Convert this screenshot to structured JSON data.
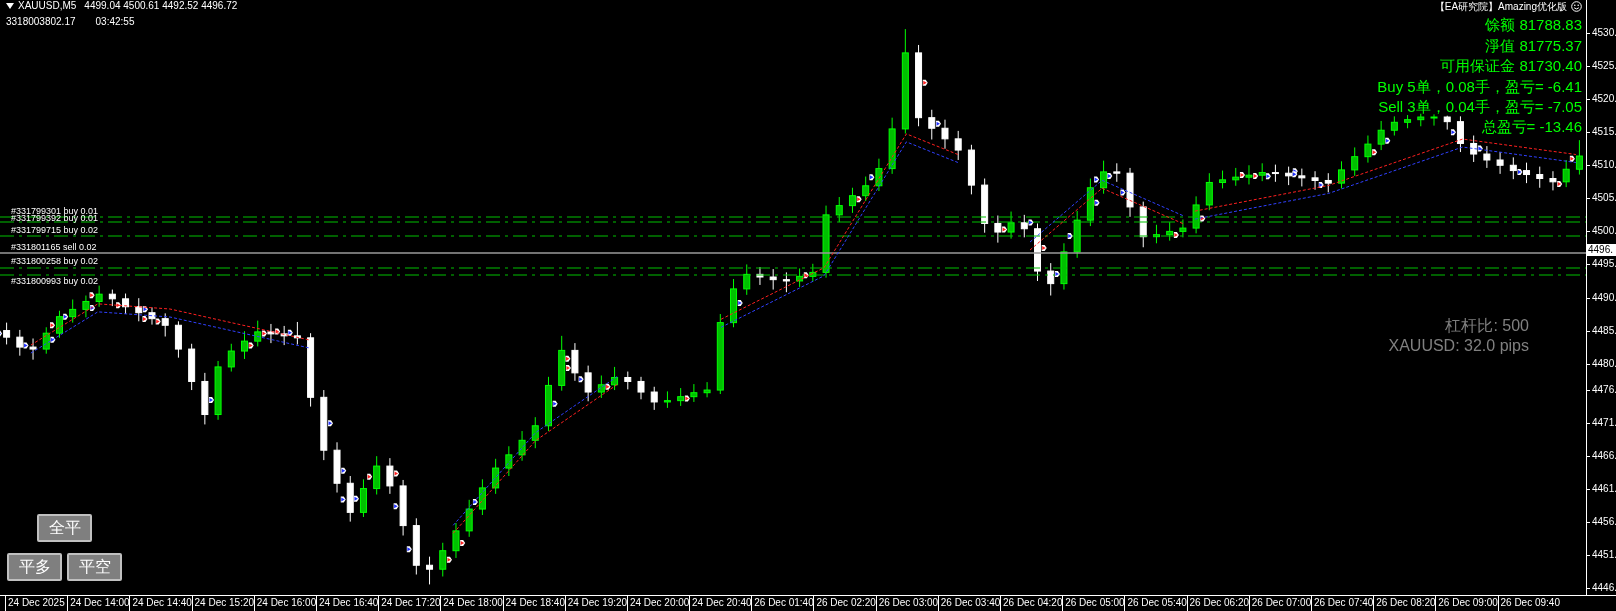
{
  "header": {
    "symbol": "XAUUSD,M5",
    "ohlc": "4499.04 4500.61 4492.52 4496.72",
    "account": "3318003802.17",
    "time": "03:42:55"
  },
  "panel": {
    "title": "【EA研究院】Amazing优化版",
    "lines": [
      {
        "text": "馀额 81788.83"
      },
      {
        "text": "淨值 81775.37"
      },
      {
        "text": "可用保证金 81730.40"
      },
      {
        "text": "Buy 5单，0.08手，盈亏= -6.41"
      },
      {
        "text": "Sell 3单，0.04手，盈亏= -7.05"
      },
      {
        "text": "总盈亏= -13.46"
      }
    ]
  },
  "info": [
    "杠杆比: 500",
    "XAUUSD: 32.0 pips"
  ],
  "order_lines": [
    {
      "label": "#331799301 buy 0.01",
      "kind": "order"
    },
    {
      "label": "#331799392 buy 0.01",
      "kind": "order"
    },
    {
      "label": "#331799715 buy 0.02",
      "kind": "order"
    },
    {
      "label": "#331801165 sell 0.02",
      "kind": "bid"
    },
    {
      "label": "#331800258 buy 0.02",
      "kind": "order"
    },
    {
      "label": "#331800993 buy 0.02",
      "kind": "order"
    }
  ],
  "buttons": [
    "全平",
    "平多",
    "平空"
  ],
  "chart": {
    "chart_data": {
      "type": "candlestick",
      "categories": [
        null,
        null,
        null,
        null,
        null,
        null,
        null,
        null,
        null,
        null,
        null,
        null,
        null,
        null,
        null,
        null,
        null,
        null,
        null,
        null,
        null,
        null,
        null,
        null,
        null,
        null,
        null,
        null,
        null,
        null,
        null,
        null,
        null,
        null,
        null,
        null,
        null,
        null,
        null,
        null,
        null,
        null,
        null,
        null,
        null,
        null,
        null,
        null,
        null,
        null,
        null,
        null,
        null,
        null,
        null,
        null,
        null,
        null,
        null,
        null,
        null,
        null,
        null,
        null,
        null,
        null,
        null,
        null,
        null,
        null,
        null,
        null,
        null,
        null,
        null,
        null,
        null,
        null,
        null,
        null,
        null,
        null,
        null,
        null,
        null,
        null,
        null,
        null,
        null,
        null,
        null,
        null,
        null,
        null,
        null,
        null,
        null,
        null,
        null,
        null,
        null,
        null,
        null,
        null,
        null,
        null,
        null,
        null,
        null,
        null,
        null,
        null,
        null,
        null,
        null,
        null,
        null,
        null,
        null,
        null
      ],
      "ylim": [
        4445,
        4535
      ],
      "yticks": [
        {
          "value": 4530,
          "label": "4530."
        },
        {
          "value": 4525,
          "label": "4525."
        },
        {
          "value": 4520,
          "label": "4520."
        },
        {
          "value": 4515,
          "label": "4515."
        },
        {
          "value": 4510,
          "label": "4510."
        },
        {
          "value": 4505,
          "label": "4505."
        },
        {
          "value": 4500,
          "label": "4500."
        },
        {
          "value": 4495,
          "label": "4495."
        },
        {
          "value": 4490,
          "label": "4490."
        },
        {
          "value": 4485,
          "label": "4485."
        },
        {
          "value": 4480,
          "label": "4480."
        },
        {
          "value": 4476,
          "label": "4476."
        },
        {
          "value": 4471,
          "label": "4471."
        },
        {
          "value": 4466,
          "label": "4466."
        },
        {
          "value": 4461,
          "label": "4461."
        },
        {
          "value": 4456,
          "label": "4456."
        },
        {
          "value": 4451,
          "label": "4451."
        },
        {
          "value": 4446,
          "label": "4446."
        }
      ],
      "ohlc": [
        [
          4485.0,
          4486.2,
          4482.9,
          4484.0
        ],
        [
          4484.0,
          4485.1,
          4481.2,
          4482.5
        ],
        [
          4482.5,
          4483.8,
          4480.6,
          4482.2
        ],
        [
          4482.2,
          4485.5,
          4481.5,
          4484.6
        ],
        [
          4484.6,
          4488.0,
          4483.9,
          4487.1
        ],
        [
          4487.1,
          4489.7,
          4486.2,
          4488.2
        ],
        [
          4488.2,
          4490.3,
          4487.0,
          4489.4
        ],
        [
          4489.4,
          4491.8,
          4488.6,
          4490.5
        ],
        [
          4490.5,
          4491.2,
          4488.7,
          4489.8
        ],
        [
          4489.8,
          4490.6,
          4487.5,
          4488.6
        ],
        [
          4488.6,
          4489.9,
          4486.4,
          4487.7
        ],
        [
          4487.7,
          4488.5,
          4485.9,
          4486.8
        ],
        [
          4486.8,
          4487.6,
          4484.1,
          4485.8
        ],
        [
          4485.8,
          4486.4,
          4480.9,
          4482.2
        ],
        [
          4482.2,
          4483.0,
          4476.0,
          4477.3
        ],
        [
          4477.3,
          4478.6,
          4470.8,
          4472.3
        ],
        [
          4472.3,
          4480.4,
          4471.5,
          4479.5
        ],
        [
          4479.5,
          4483.0,
          4478.8,
          4481.9
        ],
        [
          4481.9,
          4484.9,
          4480.7,
          4483.4
        ],
        [
          4483.4,
          4486.5,
          4482.6,
          4484.8
        ],
        [
          4484.8,
          4486.0,
          4483.1,
          4484.5
        ],
        [
          4484.5,
          4485.7,
          4482.8,
          4484.2
        ],
        [
          4484.2,
          4486.3,
          4482.9,
          4483.9
        ],
        [
          4483.9,
          4484.6,
          4473.5,
          4474.9
        ],
        [
          4474.9,
          4476.0,
          4465.4,
          4466.9
        ],
        [
          4466.9,
          4468.1,
          4460.5,
          4461.9
        ],
        [
          4461.9,
          4463.0,
          4456.1,
          4457.5
        ],
        [
          4457.5,
          4462.5,
          4456.8,
          4461.1
        ],
        [
          4461.1,
          4466.0,
          4460.2,
          4464.5
        ],
        [
          4464.5,
          4465.7,
          4460.3,
          4461.5
        ],
        [
          4461.5,
          4462.4,
          4454.0,
          4455.5
        ],
        [
          4455.5,
          4456.6,
          4448.1,
          4449.5
        ],
        [
          4449.5,
          4450.8,
          4446.6,
          4448.9
        ],
        [
          4448.9,
          4452.9,
          4447.8,
          4451.7
        ],
        [
          4451.7,
          4455.9,
          4450.6,
          4454.7
        ],
        [
          4454.7,
          4459.4,
          4453.8,
          4458.0
        ],
        [
          4458.0,
          4462.5,
          4457.1,
          4461.2
        ],
        [
          4461.2,
          4465.6,
          4460.3,
          4464.2
        ],
        [
          4464.2,
          4467.5,
          4463.0,
          4466.2
        ],
        [
          4466.2,
          4469.8,
          4465.3,
          4468.4
        ],
        [
          4468.4,
          4471.9,
          4467.2,
          4470.6
        ],
        [
          4470.6,
          4478.0,
          4469.8,
          4476.7
        ],
        [
          4476.7,
          4484.2,
          4475.9,
          4482.0
        ],
        [
          4482.0,
          4483.1,
          4477.4,
          4478.6
        ],
        [
          4478.6,
          4479.7,
          4474.3,
          4475.7
        ],
        [
          4475.7,
          4478.2,
          4474.8,
          4476.8
        ],
        [
          4476.8,
          4479.5,
          4476.0,
          4477.9
        ],
        [
          4477.9,
          4478.8,
          4476.1,
          4477.3
        ],
        [
          4477.3,
          4478.0,
          4474.6,
          4475.7
        ],
        [
          4475.7,
          4476.5,
          4473.0,
          4474.2
        ],
        [
          4474.2,
          4475.8,
          4473.3,
          4474.4
        ],
        [
          4474.4,
          4476.3,
          4473.6,
          4475.0
        ],
        [
          4475.0,
          4476.9,
          4474.2,
          4475.6
        ],
        [
          4475.6,
          4477.2,
          4474.9,
          4476.0
        ],
        [
          4476.0,
          4487.5,
          4475.4,
          4486.2
        ],
        [
          4486.2,
          4492.8,
          4485.5,
          4491.3
        ],
        [
          4491.3,
          4495.0,
          4490.4,
          4493.5
        ],
        [
          4493.5,
          4494.6,
          4491.9,
          4493.1
        ],
        [
          4493.1,
          4494.3,
          4491.2,
          4492.7
        ],
        [
          4492.7,
          4493.8,
          4490.8,
          4492.5
        ],
        [
          4492.5,
          4494.4,
          4491.6,
          4493.2
        ],
        [
          4493.2,
          4495.1,
          4492.4,
          4493.8
        ],
        [
          4493.8,
          4503.9,
          4493.0,
          4502.5
        ],
        [
          4502.5,
          4505.2,
          4501.4,
          4503.9
        ],
        [
          4503.9,
          4506.6,
          4502.8,
          4505.4
        ],
        [
          4505.4,
          4508.3,
          4504.6,
          4506.9
        ],
        [
          4506.9,
          4511.0,
          4506.1,
          4509.5
        ],
        [
          4509.5,
          4517.2,
          4508.7,
          4515.5
        ],
        [
          4515.5,
          4530.6,
          4514.8,
          4527.0
        ],
        [
          4527.0,
          4528.2,
          4515.9,
          4517.2
        ],
        [
          4517.2,
          4518.4,
          4513.9,
          4515.6
        ],
        [
          4515.6,
          4516.9,
          4512.5,
          4514.0
        ],
        [
          4514.0,
          4515.2,
          4510.8,
          4512.3
        ],
        [
          4512.3,
          4513.1,
          4505.6,
          4507.0
        ],
        [
          4507.0,
          4508.0,
          4499.8,
          4501.2
        ],
        [
          4501.2,
          4502.4,
          4498.3,
          4499.9
        ],
        [
          4499.9,
          4503.0,
          4498.9,
          4501.3
        ],
        [
          4501.3,
          4502.5,
          4499.1,
          4500.4
        ],
        [
          4500.4,
          4501.2,
          4492.5,
          4494.0
        ],
        [
          4494.0,
          4495.2,
          4490.3,
          4492.1
        ],
        [
          4492.1,
          4498.2,
          4491.2,
          4496.9
        ],
        [
          4496.9,
          4503.1,
          4496.0,
          4501.7
        ],
        [
          4501.7,
          4508.0,
          4500.8,
          4506.6
        ],
        [
          4506.6,
          4510.7,
          4505.7,
          4509.0
        ],
        [
          4509.0,
          4510.3,
          4507.5,
          4508.8
        ],
        [
          4508.8,
          4509.6,
          4502.2,
          4503.7
        ],
        [
          4503.7,
          4504.5,
          4497.6,
          4499.2
        ],
        [
          4499.2,
          4501.0,
          4498.2,
          4499.5
        ],
        [
          4499.5,
          4501.4,
          4498.6,
          4500.0
        ],
        [
          4500.0,
          4501.8,
          4499.1,
          4500.5
        ],
        [
          4500.5,
          4505.3,
          4499.7,
          4504.0
        ],
        [
          4504.0,
          4508.8,
          4503.2,
          4507.4
        ],
        [
          4507.4,
          4509.2,
          4506.5,
          4507.8
        ],
        [
          4507.8,
          4509.6,
          4506.9,
          4508.2
        ],
        [
          4508.2,
          4510.0,
          4507.1,
          4508.5
        ],
        [
          4508.5,
          4510.3,
          4507.6,
          4508.9
        ],
        [
          4508.9,
          4510.1,
          4507.5,
          4508.8
        ],
        [
          4508.8,
          4509.8,
          4507.0,
          4508.4
        ],
        [
          4508.4,
          4509.5,
          4506.8,
          4508.1
        ],
        [
          4508.1,
          4509.1,
          4506.3,
          4507.7
        ],
        [
          4507.7,
          4508.8,
          4505.9,
          4507.3
        ],
        [
          4507.3,
          4510.6,
          4506.5,
          4509.3
        ],
        [
          4509.3,
          4512.7,
          4508.4,
          4511.3
        ],
        [
          4511.3,
          4514.5,
          4510.4,
          4513.2
        ],
        [
          4513.2,
          4516.7,
          4512.3,
          4515.3
        ],
        [
          4515.3,
          4517.4,
          4514.5,
          4516.5
        ],
        [
          4516.5,
          4517.6,
          4515.6,
          4516.9
        ],
        [
          4516.9,
          4517.8,
          4515.9,
          4517.3
        ],
        [
          4517.3,
          4517.7,
          4516.0,
          4517.3
        ],
        [
          4517.3,
          4517.5,
          4515.4,
          4516.6
        ],
        [
          4516.6,
          4517.4,
          4512.0,
          4513.3
        ],
        [
          4513.3,
          4514.5,
          4510.5,
          4511.7
        ],
        [
          4511.7,
          4512.9,
          4509.6,
          4510.8
        ],
        [
          4510.8,
          4512.0,
          4508.7,
          4510.0
        ],
        [
          4510.0,
          4511.2,
          4507.9,
          4509.2
        ],
        [
          4509.2,
          4510.4,
          4507.3,
          4508.6
        ],
        [
          4508.6,
          4509.8,
          4506.6,
          4508.0
        ],
        [
          4508.0,
          4509.1,
          4506.2,
          4507.5
        ],
        [
          4507.5,
          4510.8,
          4506.7,
          4509.4
        ],
        [
          4509.4,
          4513.8,
          4508.6,
          4511.4
        ]
      ]
    }
  },
  "price_axis": {
    "current": "4496."
  },
  "time_axis": [
    "24 Dec 2025",
    "24 Dec 14:00",
    "24 Dec 14:40",
    "24 Dec 15:20",
    "24 Dec 16:00",
    "24 Dec 16:40",
    "24 Dec 17:20",
    "24 Dec 18:00",
    "24 Dec 18:40",
    "24 Dec 19:20",
    "24 Dec 20:00",
    "24 Dec 20:40",
    "26 Dec 01:40",
    "26 Dec 02:20",
    "26 Dec 03:00",
    "26 Dec 03:40",
    "26 Dec 04:20",
    "26 Dec 05:00",
    "26 Dec 05:40",
    "26 Dec 06:20",
    "26 Dec 07:00",
    "26 Dec 07:40",
    "26 Dec 08:20",
    "26 Dec 09:00",
    "26 Dec 09:40"
  ]
}
